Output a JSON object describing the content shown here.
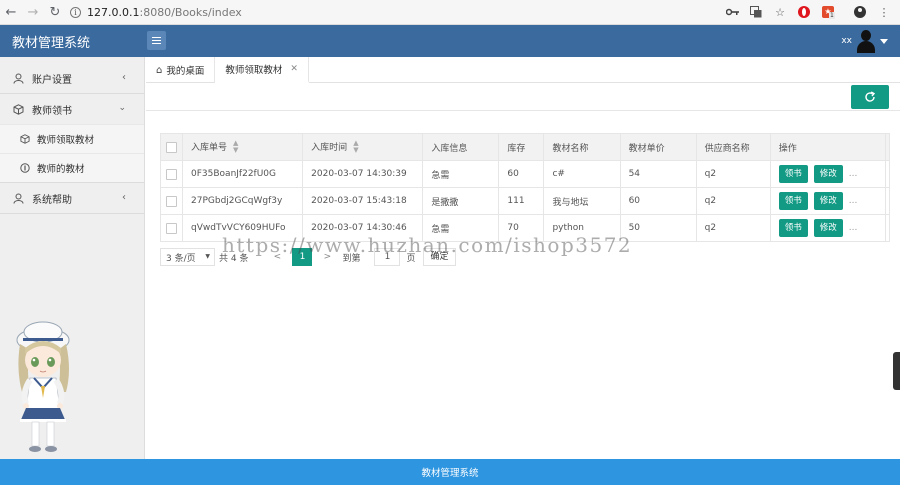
{
  "browser": {
    "url_host": "127.0.0.1",
    "url_port": ":8080",
    "url_path": "/Books/index",
    "icons": [
      "back-icon",
      "forward-icon",
      "reload-icon",
      "key-icon",
      "translate-icon",
      "star-icon",
      "opera-icon",
      "extension-icon",
      "profile-icon",
      "more-icon"
    ],
    "extension_badge": "1"
  },
  "header": {
    "title": "教材管理系统",
    "username": "xx"
  },
  "sidebar": {
    "items": [
      {
        "label": "账户设置",
        "icon": "user-icon"
      },
      {
        "label": "教师领书",
        "icon": "cube-icon",
        "subitems": [
          {
            "label": "教师领取教材",
            "icon": "cube-icon"
          },
          {
            "label": "教师的教材",
            "icon": "coin-icon"
          }
        ]
      },
      {
        "label": "系统帮助",
        "icon": "user-icon"
      }
    ]
  },
  "tabs": [
    {
      "label": "我的桌面"
    },
    {
      "label": "教师领取教材"
    }
  ],
  "table": {
    "columns": [
      "入库单号",
      "入库时间",
      "入库信息",
      "库存",
      "教材名称",
      "教材单价",
      "供应商名称",
      "操作"
    ],
    "rows": [
      {
        "id": "0F35BoanJf22fU0G",
        "time": "2020-03-07 14:30:39",
        "info": "急需",
        "stock": "60",
        "name": "c#",
        "price": "54",
        "supplier": "q2"
      },
      {
        "id": "27PGbdj2GCqWgf3y",
        "time": "2020-03-07 15:43:18",
        "info": "是撒撒",
        "stock": "111",
        "name": "我与地坛",
        "price": "60",
        "supplier": "q2"
      },
      {
        "id": "qVwdTvVCY609HUFo",
        "time": "2020-03-07 14:30:46",
        "info": "急需",
        "stock": "70",
        "name": "python",
        "price": "50",
        "supplier": "q2"
      }
    ],
    "actions": {
      "borrow": "领书",
      "edit": "修改",
      "more": "..."
    }
  },
  "pager": {
    "page_size": "3 条/页",
    "total": "共 4 条",
    "prev": "<",
    "current": "1",
    "next": ">",
    "goto_label": "到第",
    "goto_value": "1",
    "page_unit": "页",
    "confirm": "确定"
  },
  "watermark": "https://www.huzhan.com/ishop3572",
  "footer": {
    "text": "教材管理系统"
  },
  "colors": {
    "header": "#3a6a9e",
    "accent": "#139a85",
    "footer": "#2e95e0"
  }
}
